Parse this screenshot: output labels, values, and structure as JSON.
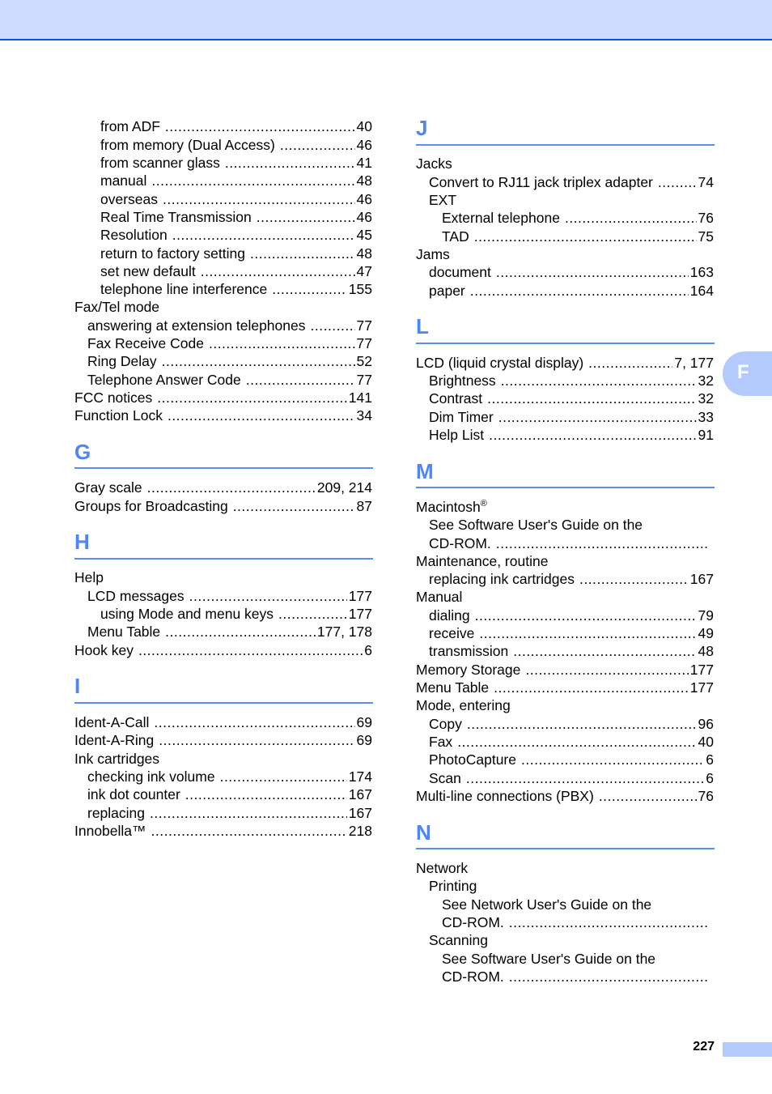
{
  "header": {
    "band_color": "#cddcfe",
    "line_color": "#0a50e6"
  },
  "side_tab": {
    "label": "F"
  },
  "footer": {
    "page_number": "227"
  },
  "left_column": {
    "continued_entries": [
      {
        "term": "from ADF",
        "page": "40"
      },
      {
        "term": "from memory (Dual Access)",
        "page": "46"
      },
      {
        "term": "from scanner glass",
        "page": "41"
      },
      {
        "term": "manual",
        "page": "48"
      },
      {
        "term": "overseas",
        "page": "46"
      },
      {
        "term": "Real Time Transmission",
        "page": "46"
      },
      {
        "term": "Resolution",
        "page": "45"
      },
      {
        "term": "return to factory setting",
        "page": "48"
      },
      {
        "term": "set new default",
        "page": "47"
      },
      {
        "term": "telephone line interference",
        "page": "155"
      },
      {
        "term": "Fax/Tel mode",
        "page": ""
      },
      {
        "term": "answering at extension telephones",
        "page": "77"
      },
      {
        "term": "Fax Receive Code",
        "page": "77"
      },
      {
        "term": "Ring Delay",
        "page": "52"
      },
      {
        "term": "Telephone Answer Code",
        "page": "77"
      },
      {
        "term": "FCC notices",
        "page": "141"
      },
      {
        "term": "Function Lock",
        "page": "34"
      }
    ],
    "sections": {
      "G": {
        "letter": "G",
        "entries": [
          {
            "term": "Gray scale",
            "page": "209, 214"
          },
          {
            "term": "Groups for Broadcasting",
            "page": "87"
          }
        ]
      },
      "H": {
        "letter": "H",
        "entries": [
          {
            "term": "Help",
            "page": ""
          },
          {
            "term": "LCD messages",
            "page": "177"
          },
          {
            "term": "using Mode and menu keys",
            "page": "177"
          },
          {
            "term": "Menu Table",
            "page": "177, 178"
          },
          {
            "term": "Hook key",
            "page": "6"
          }
        ]
      },
      "I": {
        "letter": "I",
        "entries": [
          {
            "term": "Ident-A-Call",
            "page": "69"
          },
          {
            "term": "Ident-A-Ring",
            "page": "69"
          },
          {
            "term": "Ink cartridges",
            "page": ""
          },
          {
            "term": "checking ink volume",
            "page": "174"
          },
          {
            "term": "ink dot counter",
            "page": "167"
          },
          {
            "term": "replacing",
            "page": "167"
          },
          {
            "term": "Innobella™",
            "page": "218"
          }
        ]
      }
    }
  },
  "right_column": {
    "sections": {
      "J": {
        "letter": "J",
        "entries": [
          {
            "term": "Jacks",
            "page": ""
          },
          {
            "term": "Convert to RJ11 jack triplex adapter",
            "page": "74"
          },
          {
            "term": "EXT",
            "page": ""
          },
          {
            "term": "External telephone",
            "page": "76"
          },
          {
            "term": "TAD",
            "page": "75"
          },
          {
            "term": "Jams",
            "page": ""
          },
          {
            "term": "document",
            "page": "163"
          },
          {
            "term": "paper",
            "page": "164"
          }
        ]
      },
      "L": {
        "letter": "L",
        "entries": [
          {
            "term": "LCD (liquid crystal display)",
            "page": "7, 177"
          },
          {
            "term": "Brightness",
            "page": "32"
          },
          {
            "term": "Contrast",
            "page": "32"
          },
          {
            "term": "Dim Timer",
            "page": "33"
          },
          {
            "term": "Help List",
            "page": "91"
          }
        ]
      },
      "M": {
        "letter": "M",
        "entries": [
          {
            "term": "Macintosh",
            "sup": "®",
            "page": ""
          },
          {
            "term": "See Software User's Guide on the",
            "page": ""
          },
          {
            "term": "CD-ROM.",
            "page": ""
          },
          {
            "term": "Maintenance, routine",
            "page": ""
          },
          {
            "term": "replacing ink cartridges",
            "page": "167"
          },
          {
            "term": "Manual",
            "page": ""
          },
          {
            "term": "dialing",
            "page": "79"
          },
          {
            "term": "receive",
            "page": "49"
          },
          {
            "term": "transmission",
            "page": "48"
          },
          {
            "term": "Memory Storage",
            "page": "177"
          },
          {
            "term": "Menu Table",
            "page": "177"
          },
          {
            "term": "Mode, entering",
            "page": ""
          },
          {
            "term": "Copy",
            "page": "96"
          },
          {
            "term": "Fax",
            "page": "40"
          },
          {
            "term": "PhotoCapture",
            "page": "6"
          },
          {
            "term": "Scan",
            "page": "6"
          },
          {
            "term": "Multi-line connections (PBX)",
            "page": "76"
          }
        ]
      },
      "N": {
        "letter": "N",
        "entries": [
          {
            "term": "Network",
            "page": ""
          },
          {
            "term": "Printing",
            "page": ""
          },
          {
            "term": "See Network User's Guide on the",
            "page": ""
          },
          {
            "term": "CD-ROM.",
            "page": ""
          },
          {
            "term": "Scanning",
            "page": ""
          },
          {
            "term": "See Software User's Guide on the",
            "page": ""
          },
          {
            "term": "CD-ROM.",
            "page": ""
          }
        ]
      }
    }
  }
}
